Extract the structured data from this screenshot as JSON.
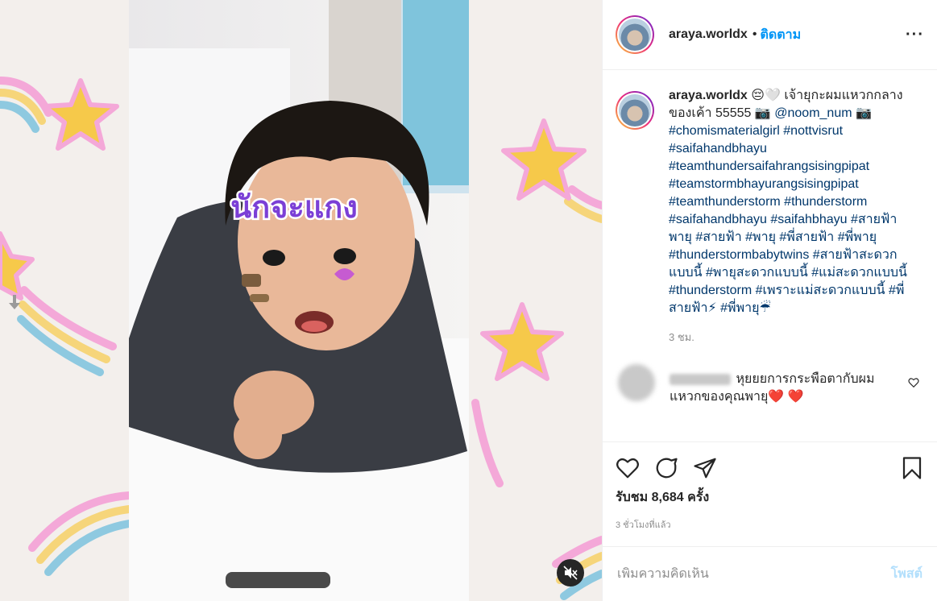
{
  "colors": {
    "accent": "#0095f6",
    "hashtag": "#00376b",
    "muted": "#8e8e8e",
    "post_disabled": "#b2dffc"
  },
  "media": {
    "sticker_text": "นักจะแกง",
    "mute_icon": "speaker-muted-icon"
  },
  "header": {
    "username": "araya.worldx",
    "separator": "•",
    "follow_label": "ติดตาม",
    "more_label": "···"
  },
  "caption": {
    "username": "araya.worldx",
    "text_1": " 😔🤍 เจ้ายุกะผมแหวกกลางของเค้า 55555 📷 ",
    "mention": "@noom_num",
    "text_2": " 📷 ",
    "hashtags": "#chomismaterialgirl #nottvisrut #saifahandbhayu #teamthundersaifahrangsisingpipat #teamstormbhayurangsisingpipat #teamthunderstorm #thunderstorm #saifahandbhayu #saifahbhayu #สายฟ้าพายุ #สายฟ้า #พายุ #พี่สายฟ้า #พี่พายุ #thunderstormbabytwins #สายฟ้าสะดวกแบบนี้ #พายุสะดวกแบบนี้ #แม่สะดวกแบบนี้ #thunderstorm #เพราะแม่สะดวกแบบนี้ #พี่สายฟ้า⚡ #พี่พายุ☔",
    "time": "3 ชม."
  },
  "comment": {
    "text": "หุยยยการกระพือตากับผมแหวกของคุณพายุ❤️ ❤️"
  },
  "actions": {
    "likes": "รับชม 8,684 ครั้ง",
    "time": "3 ชั่วโมงที่แล้ว"
  },
  "add_comment": {
    "placeholder": "เพิ่มความคิดเห็น",
    "post_label": "โพสต์"
  }
}
